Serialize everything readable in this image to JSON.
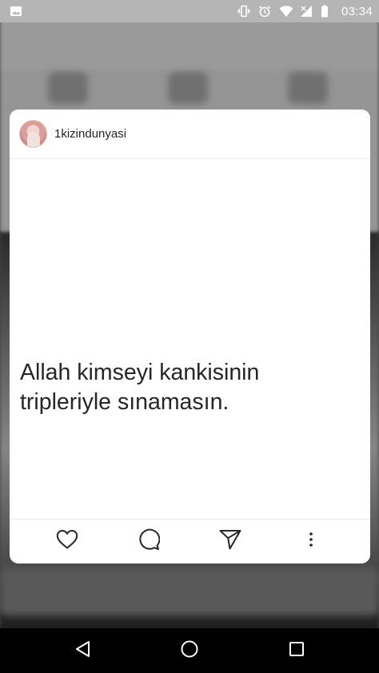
{
  "status_bar": {
    "time": "03:34",
    "icons": [
      "image-icon",
      "vibrate-icon",
      "alarm-icon",
      "wifi-icon",
      "signal-icon",
      "battery-icon"
    ]
  },
  "post": {
    "username": "1kizindunyasi",
    "text": "Allah kimseyi kankisinin tripleriyle sınamasın.",
    "actions": [
      "heart-icon",
      "comment-icon",
      "share-icon",
      "more-icon"
    ]
  },
  "nav": {
    "buttons": [
      "back-icon",
      "home-icon",
      "recents-icon"
    ]
  },
  "colors": {
    "text": "#262626",
    "card": "#ffffff",
    "status_bar": "#b5b5b5",
    "nav_bar": "#000000"
  }
}
